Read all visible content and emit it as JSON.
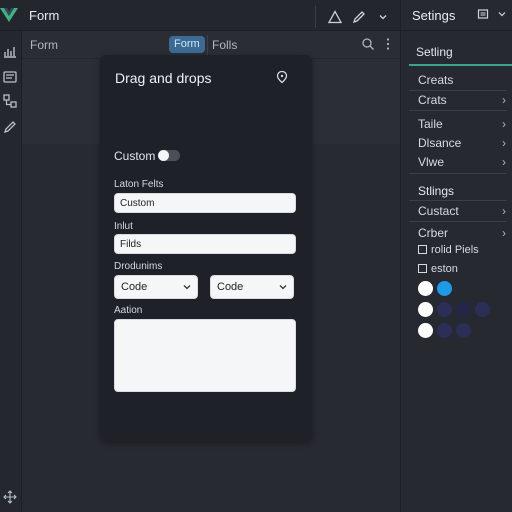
{
  "app": {
    "title": "Form",
    "icons": [
      "warning-icon",
      "pen-icon",
      "chevron-down-icon"
    ]
  },
  "left_rail": {
    "icons": [
      "chart-icon",
      "form-icon",
      "components-icon",
      "edit-icon",
      "move-icon"
    ]
  },
  "subbar": {
    "title": "Form",
    "tabs": [
      {
        "label": "Form",
        "active": true
      },
      {
        "label": "Folls",
        "active": false
      }
    ],
    "icons": [
      "search-icon",
      "more-vertical-icon"
    ]
  },
  "card": {
    "title": "Drag and drops",
    "custom_toggle": {
      "label": "Custom",
      "on": false
    },
    "fields": [
      {
        "label": "Laton Felts",
        "value": "Custom"
      },
      {
        "label": "Inlut",
        "value": "Filds"
      }
    ],
    "dropdowns": {
      "label": "Drodunims",
      "selects": [
        {
          "value": "Code"
        },
        {
          "value": "Code"
        }
      ]
    },
    "textarea": {
      "label": "Aation",
      "value": ""
    }
  },
  "right_panel": {
    "title": "Setings",
    "header_icons": [
      "panel-icon",
      "chevron-down-icon"
    ],
    "tab": "Setling",
    "items": [
      {
        "label": "Creats",
        "has_arrow": false
      },
      {
        "label": "Crats",
        "has_arrow": true
      },
      {
        "label": "Taile",
        "has_arrow": true
      },
      {
        "label": "Dlsance",
        "has_arrow": true
      },
      {
        "label": "Vlwe",
        "has_arrow": true
      }
    ],
    "section_title": "Stlings",
    "section_items": [
      {
        "label": "Custact",
        "has_arrow": true
      },
      {
        "label": "Crber",
        "has_arrow": true
      }
    ],
    "checkboxes": [
      {
        "label": "rolid Piels",
        "checked": false
      },
      {
        "label": "eston",
        "checked": false
      }
    ],
    "swatches": [
      [
        "#ffffff",
        "#1e9be8"
      ],
      [
        "#ffffff",
        "#2b2f57",
        "#232648",
        "#2b2f57"
      ],
      [
        "#ffffff",
        "#2b2f57",
        "#2b2f57"
      ]
    ]
  },
  "colors": {
    "accent": "#3aa58a",
    "tab_active": "#3b6b94",
    "brand_logo": "#3fb27f"
  }
}
